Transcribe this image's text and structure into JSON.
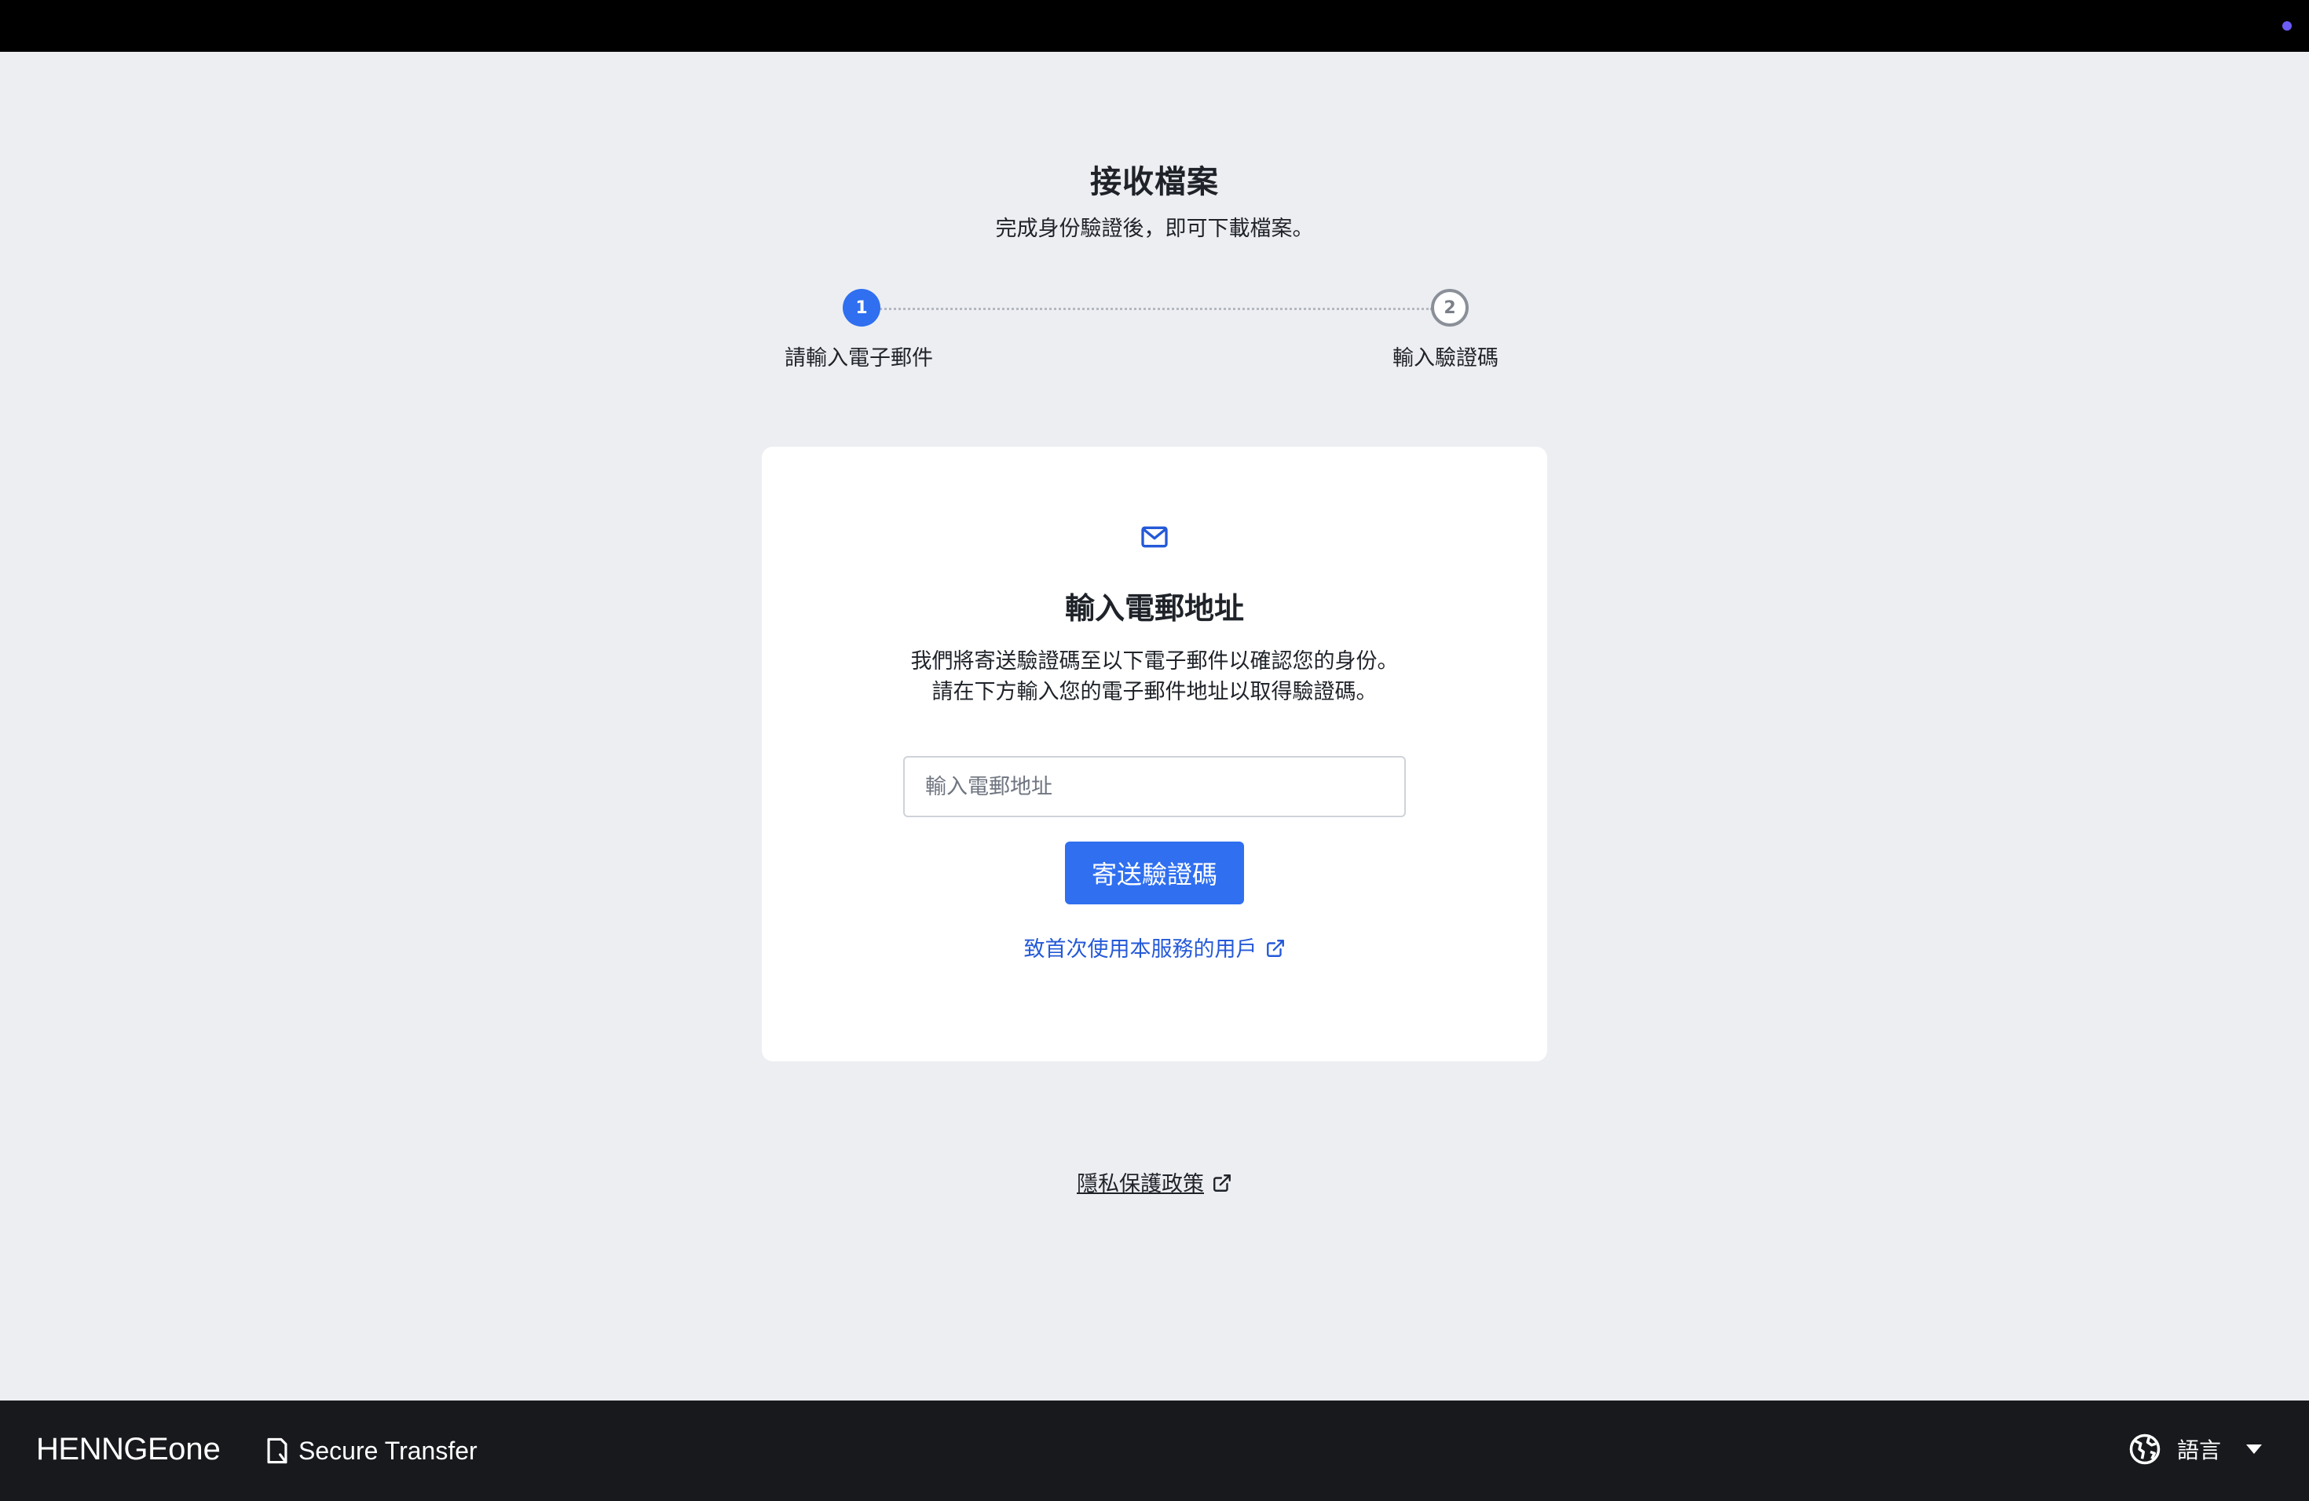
{
  "header": {
    "title": "接收檔案",
    "subtitle": "完成身份驗證後，即可下載檔案。"
  },
  "stepper": {
    "steps": [
      {
        "number": "1",
        "label": "請輸入電子郵件",
        "state": "active"
      },
      {
        "number": "2",
        "label": "輸入驗證碼",
        "state": "inactive"
      }
    ]
  },
  "card": {
    "icon": "mail-icon",
    "title": "輸入電郵地址",
    "description_line1": "我們將寄送驗證碼至以下電子郵件以確認您的身份。",
    "description_line2": "請在下方輸入您的電子郵件地址以取得驗證碼。",
    "email_input": {
      "placeholder": "輸入電郵地址",
      "value": ""
    },
    "send_button_label": "寄送驗證碼",
    "first_time_link_label": "致首次使用本服務的用戶"
  },
  "privacy_link_label": "隱私保護政策",
  "footer": {
    "brand_part1": "HENNGE",
    "brand_part2": "one",
    "product_name": "Secure Transfer",
    "language_label": "語言"
  },
  "colors": {
    "accent": "#2f6ff0",
    "link": "#2459d8",
    "page_bg": "#edeef2",
    "footer_bg": "#17191d",
    "top_bar_bg": "#000000"
  }
}
